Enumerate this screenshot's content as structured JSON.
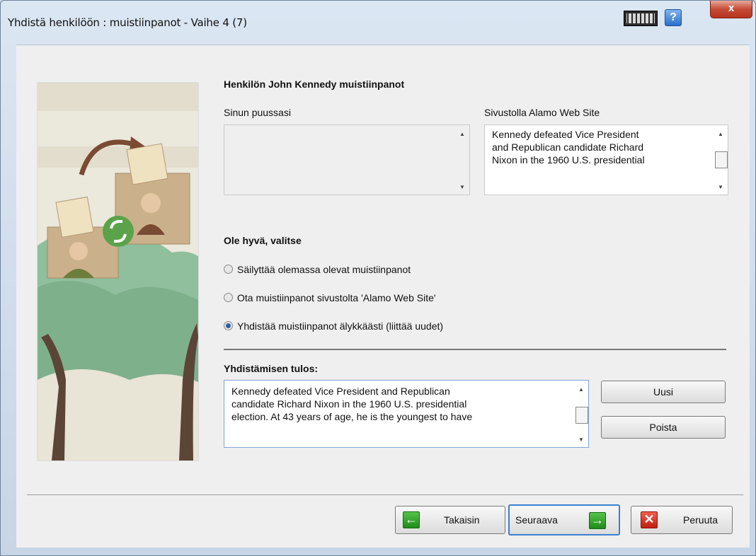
{
  "window": {
    "title": "Yhdistä henkilöön : muistiinpanot - Vaihe 4 (7)",
    "help_label": "?",
    "close_label": "x"
  },
  "header": {
    "heading": "Henkilön John Kennedy    muistiinpanot"
  },
  "left_panel": {
    "label": "Sinun puussasi",
    "text": ""
  },
  "right_panel": {
    "label": "Sivustolla Alamo Web Site",
    "text_lines": [
      "Kennedy defeated Vice President",
      "and Republican candidate Richard",
      "Nixon in the 1960 U.S. presidential"
    ]
  },
  "choice": {
    "heading": "Ole hyvä, valitse",
    "options": [
      {
        "label": "Säilyttää olemassa olevat muistiinpanot",
        "selected": false
      },
      {
        "label": "Ota muistiinpanot sivustolta 'Alamo Web Site'",
        "selected": false
      },
      {
        "label": "Yhdistää muistiinpanot älykkäästi (liittää uudet)",
        "selected": true
      }
    ]
  },
  "result": {
    "heading": "Yhdistämisen tulos:",
    "text_lines": [
      "Kennedy defeated Vice President and Republican",
      "candidate Richard Nixon in the 1960 U.S. presidential",
      "election. At 43 years of age, he is the youngest to have"
    ]
  },
  "actions": {
    "new_label": "Uusi",
    "delete_label": "Poista"
  },
  "footer": {
    "back_label": "Takaisin",
    "next_label": "Seuraava",
    "cancel_label": "Peruuta"
  },
  "colors": {
    "accent": "#2e5fa3",
    "green_icon": "#2f9a28",
    "red_icon": "#d8301c"
  }
}
